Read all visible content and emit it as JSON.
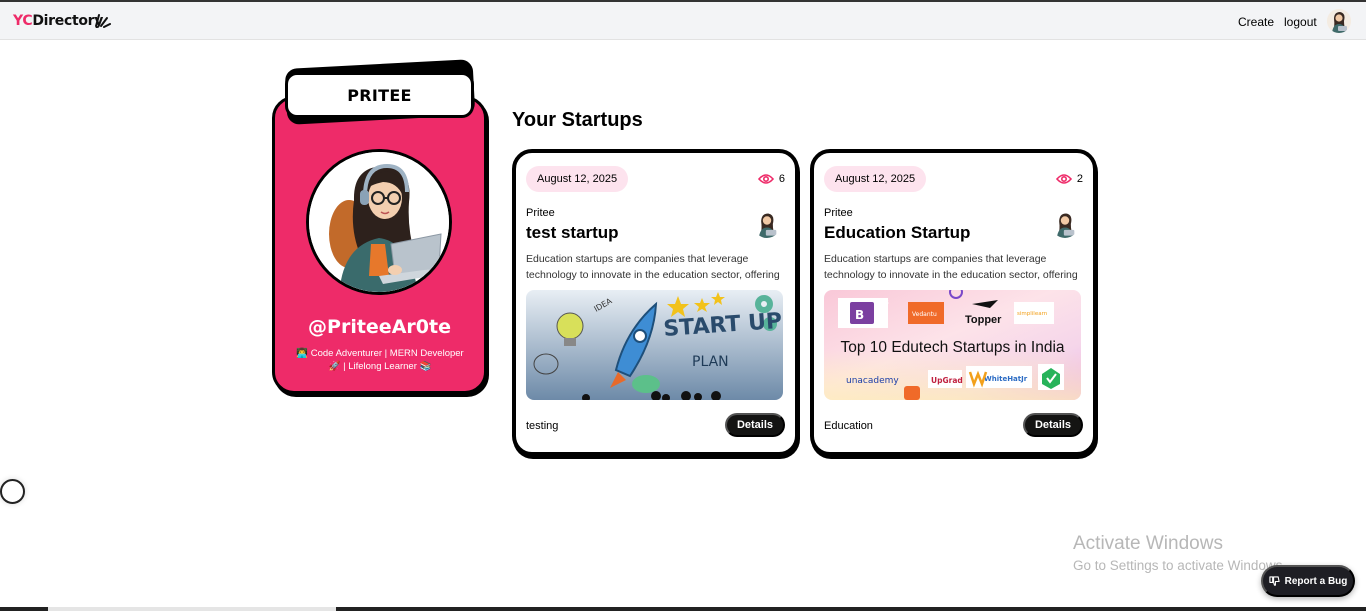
{
  "navbar": {
    "logo_prefix": "YC",
    "logo_suffix": "Directory",
    "create_label": "Create",
    "logout_label": "logout",
    "accent_color": "#ee2b69"
  },
  "profile": {
    "name": "PRITEE",
    "handle": "@PriteeAr0te",
    "bio": "👨‍💻 Code Adventurer | MERN Developer 🚀 | Lifelong Learner 📚"
  },
  "section": {
    "title": "Your Startups"
  },
  "startups": [
    {
      "date": "August 12, 2025",
      "views": "6",
      "author": "Pritee",
      "title": "test startup",
      "description": "Education startups are companies that leverage technology to innovate in the education sector, offering n...",
      "category": "testing",
      "details_label": "Details",
      "image_text": [
        "START UP",
        "PLAN",
        "IDEA"
      ]
    },
    {
      "date": "August 12, 2025",
      "views": "2",
      "author": "Pritee",
      "title": "Education Startup",
      "description": "Education startups are companies that leverage technology to innovate in the education sector, offering n...",
      "category": "Education",
      "details_label": "Details",
      "image_text": [
        "Top 10 Edutech Startups in India",
        "Vedantu",
        "Topper",
        "simplilearn",
        "unacademy",
        "UpGrad",
        "WhiteHatJr",
        "BYJU'S"
      ]
    }
  ],
  "watermark": {
    "title": "Activate Windows",
    "subtitle": "Go to Settings to activate Windows."
  },
  "report_bug_label": "Report a Bug"
}
